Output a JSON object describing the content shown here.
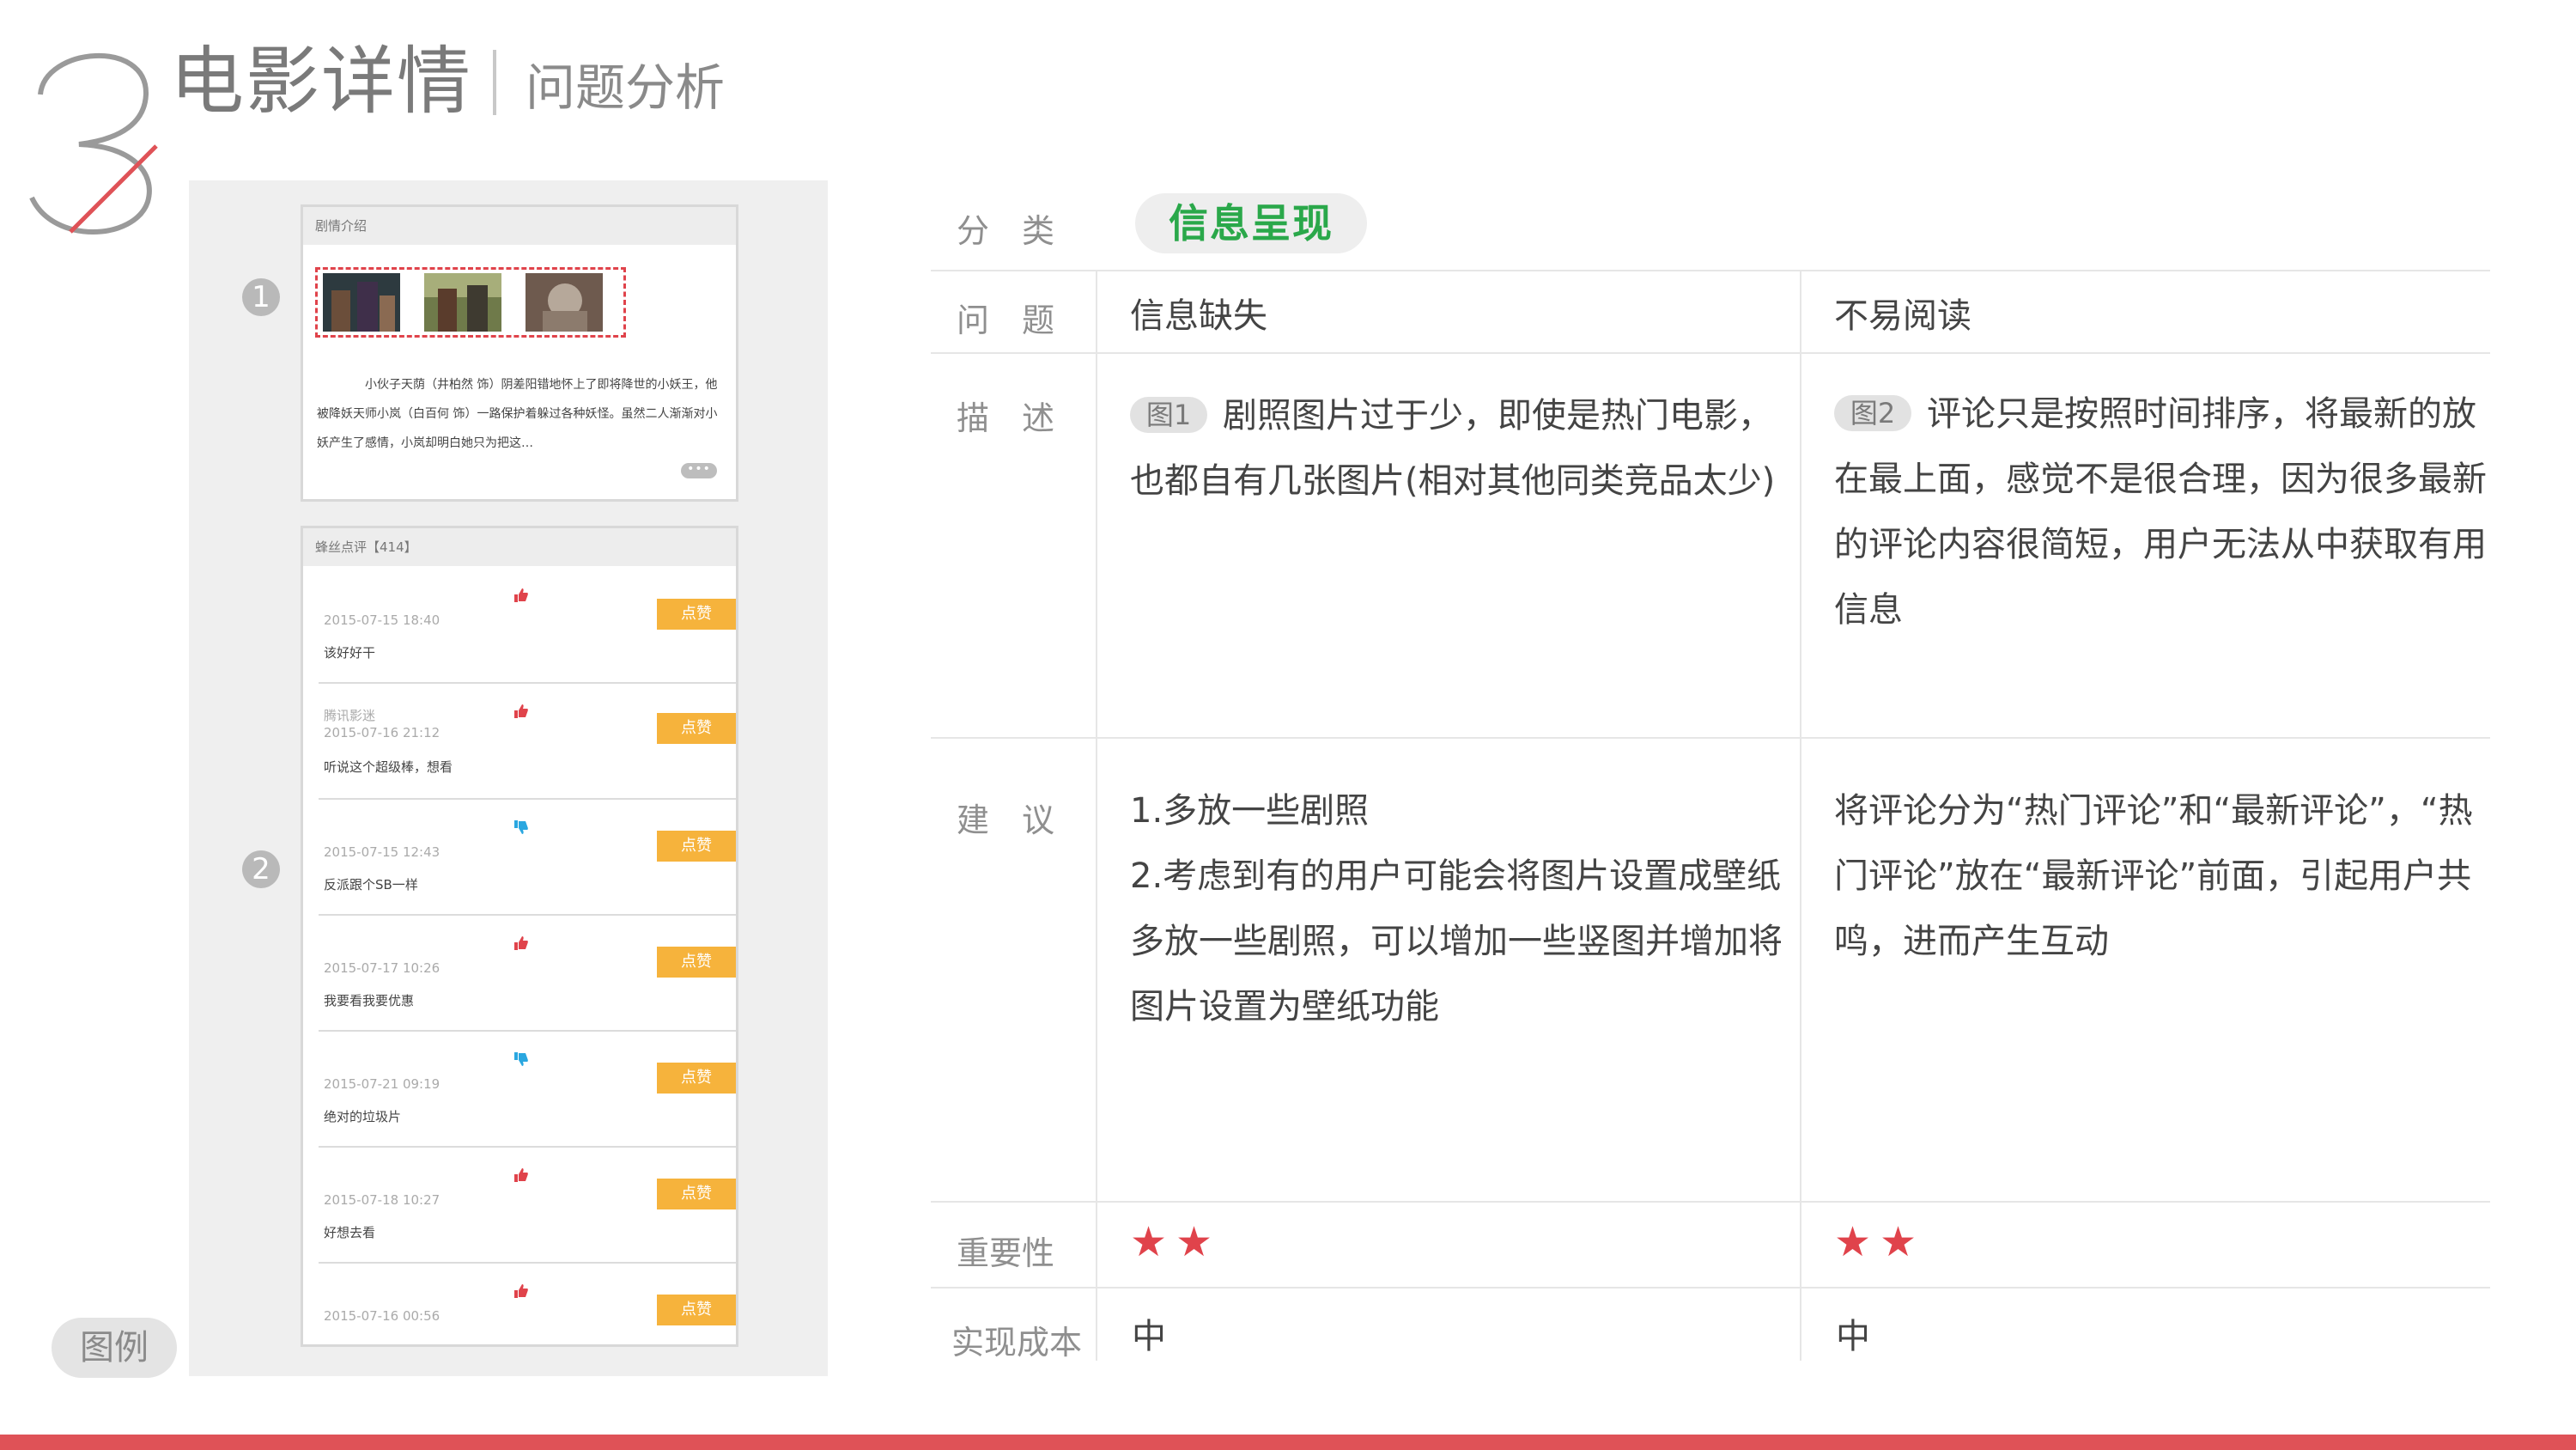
{
  "header": {
    "section_number": "3",
    "title": "电影详情",
    "subtitle": "问题分析"
  },
  "left_panel": {
    "marker_1": "1",
    "marker_2": "2",
    "synopsis_card": {
      "header": "剧情介绍",
      "text": "小伙子天荫（井柏然 饰）阴差阳错地怀上了即将降世的小妖王，他被降妖天师小岚（白百何 饰）一路保护着躲过各种妖怪。虽然二人渐渐对小妖产生了感情，小岚却明白她只为把这…",
      "more": "•••"
    },
    "reviews_card": {
      "header": "蜂丝点评【414】",
      "like_label": "点赞",
      "reviews": [
        {
          "author": "",
          "date": "2015-07-15 18:40",
          "text": "该好好干",
          "thumb": "up"
        },
        {
          "author": "腾讯影迷",
          "date": "2015-07-16 21:12",
          "text": "听说这个超级棒，想看",
          "thumb": "up"
        },
        {
          "author": "",
          "date": "2015-07-15 12:43",
          "text": "反派跟个SB一样",
          "thumb": "down"
        },
        {
          "author": "",
          "date": "2015-07-17 10:26",
          "text": "我要看我要优惠",
          "thumb": "up"
        },
        {
          "author": "",
          "date": "2015-07-21 09:19",
          "text": "绝对的垃圾片",
          "thumb": "down"
        },
        {
          "author": "",
          "date": "2015-07-18 10:27",
          "text": "好想去看",
          "thumb": "up"
        },
        {
          "author": "",
          "date": "2015-07-16 00:56",
          "text": "",
          "thumb": "up"
        }
      ]
    },
    "legend": "图例"
  },
  "table": {
    "labels": {
      "category": "分　类",
      "problem": "问　题",
      "description": "描　述",
      "suggestion": "建　议",
      "importance": "重要性",
      "cost": "实现成本"
    },
    "category": "信息呈现",
    "col1": {
      "problem": "信息缺失",
      "fig_tag": "图1",
      "description": "剧照图片过于少，即使是热门电影，也都自有几张图片(相对其他同类竞品太少)",
      "suggestion_1": "1.多放一些剧照",
      "suggestion_2": "2.考虑到有的用户可能会将图片设置成壁纸多放一些剧照，可以增加一些竖图并增加将图片设置为壁纸功能",
      "importance": "★★",
      "cost": "中"
    },
    "col2": {
      "problem": "不易阅读",
      "fig_tag": "图2",
      "description": "评论只是按照时间排序，将最新的放在最上面，感觉不是很合理，因为很多最新的评论内容很简短，用户无法从中获取有用信息",
      "suggestion": "将评论分为“热门评论”和“最新评论”，“热门评论”放在“最新评论”前面，引起用户共鸣，进而产生互动",
      "importance": "★★",
      "cost": "中"
    }
  },
  "colors": {
    "accent_red": "#df5257",
    "category_green": "#2aa84a",
    "like_orange": "#f6b33c",
    "star_red": "#e0434b",
    "thumb_up": "#e0434b",
    "thumb_down": "#2aa7e0"
  },
  "icons": {
    "thumb_up": "thumb-up-icon",
    "thumb_down": "thumb-down-icon"
  }
}
